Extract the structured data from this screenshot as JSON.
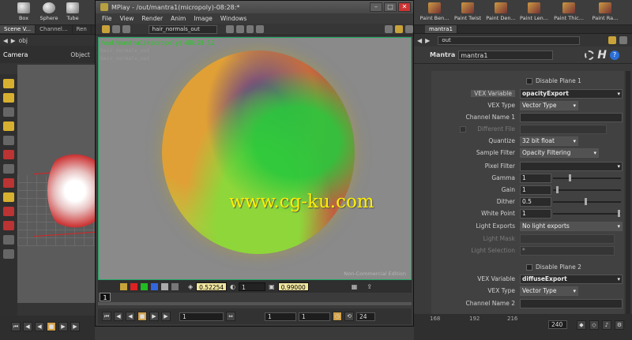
{
  "shelf": {
    "tools": [
      {
        "label": "Box",
        "icon": "box-icon"
      },
      {
        "label": "Sphere",
        "icon": "sphere-icon"
      },
      {
        "label": "Tube",
        "icon": "tube-icon"
      }
    ],
    "paint_tools": [
      {
        "label": "Paint Ben..."
      },
      {
        "label": "Paint Twist"
      },
      {
        "label": "Paint Den..."
      },
      {
        "label": "Paint Len..."
      },
      {
        "label": "Paint Thic..."
      },
      {
        "label": "Paint Ra..."
      }
    ]
  },
  "left": {
    "tabs": [
      "Scene V...",
      "Channel...",
      "Ren"
    ],
    "path": "obj",
    "viewport_label": "Camera",
    "object_label": "Object"
  },
  "mplay": {
    "title": "MPlay - /out/mantra1(micropoly)-08:28:*",
    "menu": [
      "File",
      "View",
      "Render",
      "Anim",
      "Image",
      "Windows"
    ],
    "layer": "hair_normals_out",
    "render_title": "/out/mantra1(micropoly)-08:28:12",
    "render_sub1": "hair_normals_out",
    "render_sub2": "hair_normals_out",
    "watermark": "www.cg-ku.com",
    "edition": "Non-Commercial Edition",
    "ctrl": {
      "value1": "0.52254",
      "value2": "1",
      "value3": "0.99000"
    },
    "frame": "1",
    "play": {
      "start": "1",
      "f1": "1",
      "f2": "1",
      "end": "24"
    }
  },
  "right": {
    "tab": "mantra1",
    "path": "out",
    "node_type": "Mantra",
    "node_name": "mantra1",
    "params": {
      "disable_plane_1": "Disable Plane 1",
      "vex_variable_label": "VEX Variable",
      "vex_variable_1": "opacityExport",
      "vex_type_label": "VEX Type",
      "vex_type_1": "Vector Type",
      "channel_name_1_label": "Channel Name 1",
      "different_file_label": "Different File",
      "quantize_label": "Quantize",
      "quantize": "32 bit float",
      "sample_filter_label": "Sample Filter",
      "sample_filter": "Opacity Filtering",
      "pixel_filter_label": "Pixel Filter",
      "gamma_label": "Gamma",
      "gamma": "1",
      "gain_label": "Gain",
      "gain": "1",
      "dither_label": "Dither",
      "dither": "0.5",
      "white_point_label": "White Point",
      "white_point": "1",
      "light_exports_label": "Light Exports",
      "light_exports": "No light exports",
      "light_mask_label": "Light Mask",
      "light_selection_label": "Light Selection",
      "light_selection": "*",
      "disable_plane_2": "Disable Plane 2",
      "vex_variable_2": "diffuseExport",
      "vex_type_2": "Vector Type",
      "channel_name_2_label": "Channel Name 2"
    },
    "timeline": {
      "ticks": [
        "168",
        "192",
        "216"
      ],
      "end": "240"
    }
  }
}
